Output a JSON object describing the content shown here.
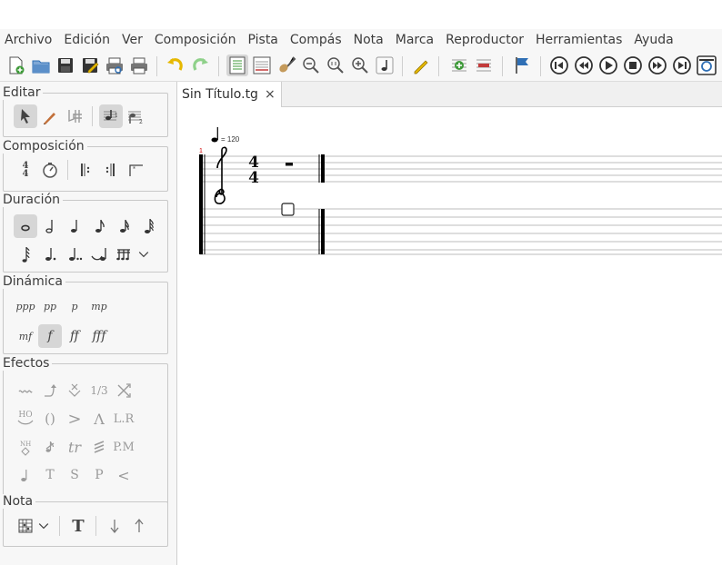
{
  "menubar": {
    "items": [
      "Archivo",
      "Edición",
      "Ver",
      "Composición",
      "Pista",
      "Compás",
      "Nota",
      "Marca",
      "Reproductor",
      "Herramientas",
      "Ayuda"
    ]
  },
  "panel": {
    "editar": {
      "title": "Editar"
    },
    "composicion": {
      "title": "Composición"
    },
    "duracion": {
      "title": "Duración"
    },
    "dinamica": {
      "title": "Dinámica",
      "items": [
        "ppp",
        "pp",
        "p",
        "mp",
        "mf",
        "f",
        "ff",
        "fff"
      ],
      "selected": "f"
    },
    "efectos": {
      "title": "Efectos",
      "labels": {
        "triplet": "1/3",
        "lr": "L.R",
        "tr": "tr",
        "pm": "P.M",
        "t": "T",
        "s": "S",
        "p": "P",
        "lt": "<",
        "gt": ">",
        "paren": "()",
        "caret": "Λ",
        "ho": "HO",
        "nh": "NH"
      }
    },
    "nota": {
      "title": "Nota",
      "text_label": "T"
    }
  },
  "tab": {
    "title": "Sin Título.tg",
    "close": "×"
  },
  "score": {
    "measure_number": "1",
    "tempo": "= 120",
    "time_signature": {
      "top": "4",
      "bottom": "4"
    }
  },
  "colors": {
    "accent_blue": "#2f6fb5",
    "green": "#3f9a3a",
    "red": "#c23b3b",
    "yellow": "#e6b800",
    "measure_number_red": "#d00000"
  }
}
